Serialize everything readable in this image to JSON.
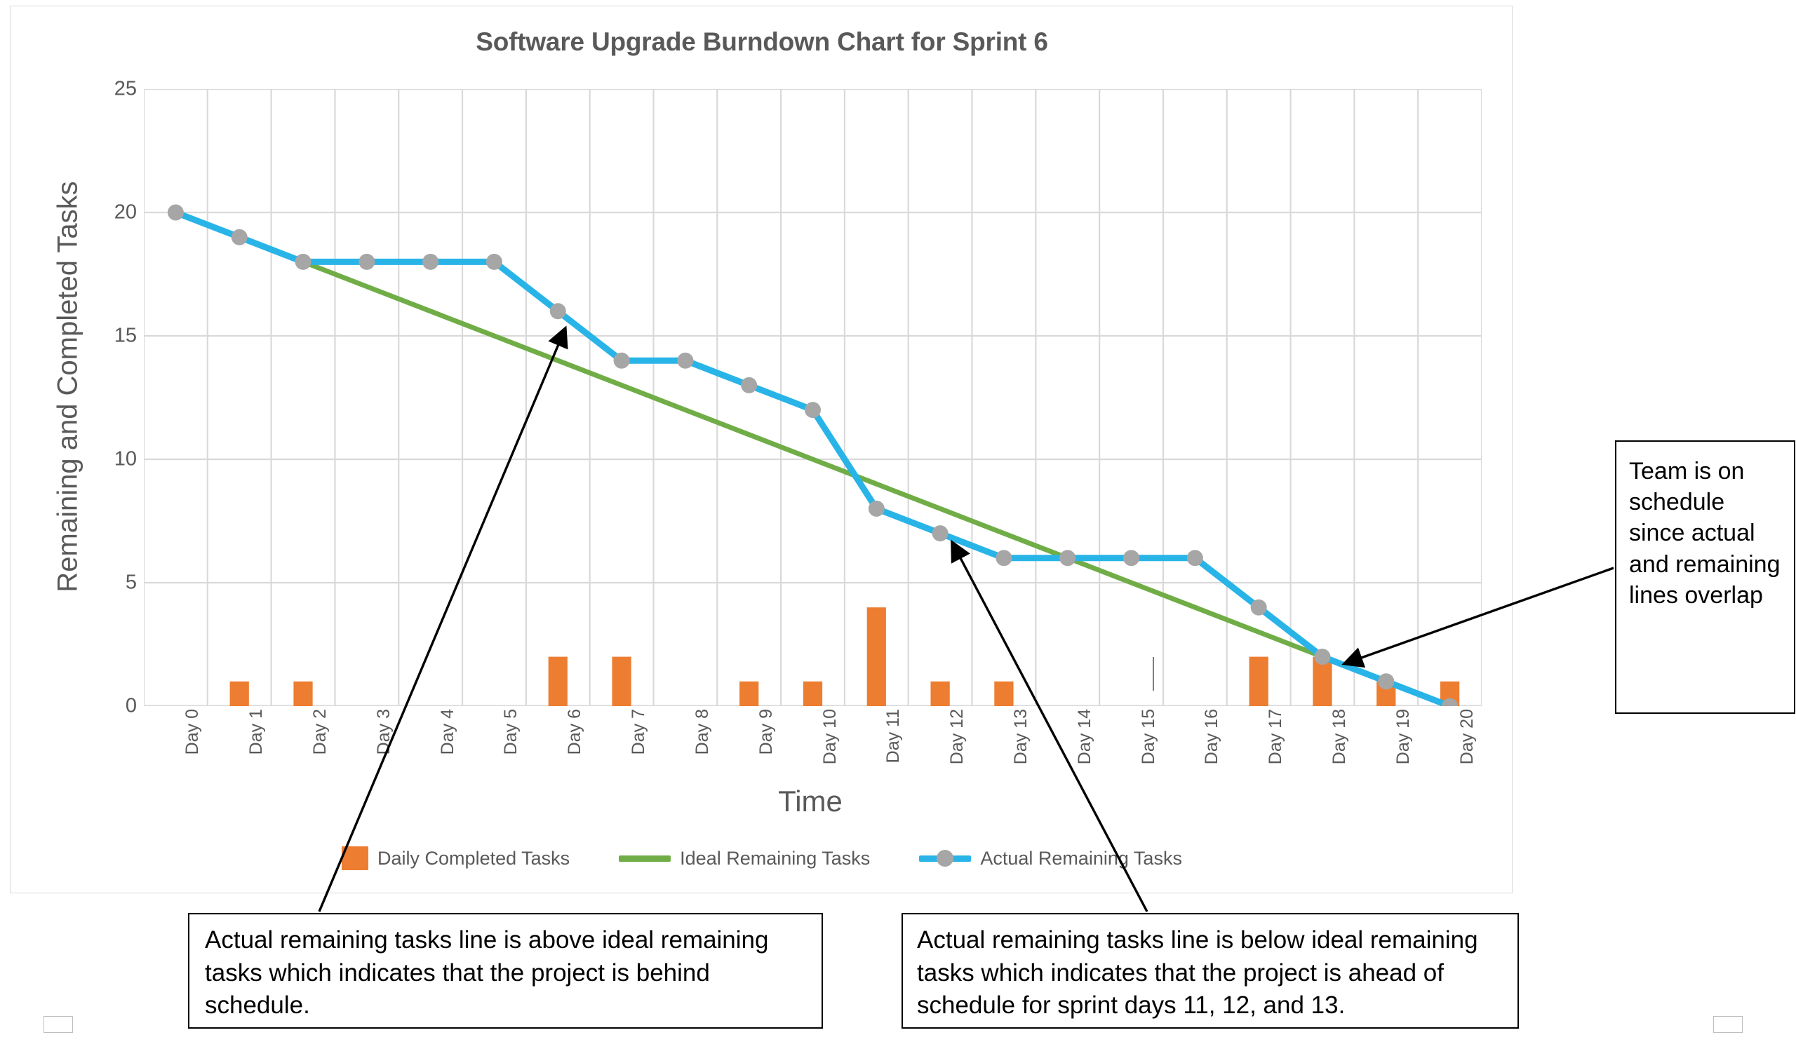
{
  "chart_data": {
    "type": "bar",
    "title": "Software Upgrade Burndown Chart for Sprint 6",
    "xlabel": "Time",
    "ylabel": "Remaining and Completed Tasks",
    "ylim": [
      0,
      25
    ],
    "yticks": [
      0,
      5,
      10,
      15,
      20,
      25
    ],
    "grid": true,
    "legend_position": "bottom",
    "categories": [
      "Day 0",
      "Day 1",
      "Day 2",
      "Day 3",
      "Day 4",
      "Day 5",
      "Day 6",
      "Day 7",
      "Day 8",
      "Day 9",
      "Day 10",
      "Day 11",
      "Day 12",
      "Day 13",
      "Day 14",
      "Day 15",
      "Day 16",
      "Day 17",
      "Day 18",
      "Day 19",
      "Day 20"
    ],
    "series": [
      {
        "name": "Daily Completed Tasks",
        "type": "bar",
        "color": "#ED7D31",
        "values": [
          0,
          1,
          1,
          0,
          0,
          0,
          2,
          2,
          0,
          1,
          1,
          4,
          1,
          1,
          0,
          0,
          0,
          2,
          2,
          1,
          1
        ]
      },
      {
        "name": "Ideal Remaining Tasks",
        "type": "line",
        "color": "#70AD47",
        "values": [
          null,
          null,
          18,
          17,
          16,
          15,
          14,
          13,
          12,
          11,
          10,
          9,
          8,
          7,
          6,
          5,
          4,
          3,
          2,
          1,
          0
        ]
      },
      {
        "name": "Actual Remaining Tasks",
        "type": "line",
        "color": "#29B4E8",
        "marker_color": "#A6A6A6",
        "values": [
          20,
          19,
          18,
          18,
          18,
          18,
          16,
          14,
          14,
          13,
          12,
          8,
          7,
          6,
          6,
          6,
          6,
          4,
          2,
          1,
          0
        ]
      }
    ]
  },
  "chart": {
    "title": "Software Upgrade Burndown Chart for Sprint 6",
    "x_axis_title": "Time",
    "y_axis_title": "Remaining and Completed Tasks"
  },
  "legend": {
    "items": [
      {
        "label": "Daily Completed Tasks",
        "color": "#ED7D31",
        "marker": "bar"
      },
      {
        "label": "Ideal Remaining Tasks",
        "color": "#70AD47",
        "marker": "line"
      },
      {
        "label": "Actual Remaining Tasks",
        "color": "#29B4E8",
        "marker": "line-dot"
      }
    ]
  },
  "annotations": [
    {
      "id": "behind-schedule",
      "text": "Actual remaining tasks line is above ideal remaining tasks which indicates that the project is behind schedule."
    },
    {
      "id": "ahead-of-schedule",
      "text": "Actual remaining tasks line is below ideal remaining tasks which indicates that the project is ahead of schedule for sprint days 11, 12, and 13."
    },
    {
      "id": "on-schedule",
      "text": "Team is on schedule since actual and remaining lines overlap"
    }
  ],
  "colors": {
    "bar": "#ED7D31",
    "ideal_line": "#70AD47",
    "actual_line": "#29B4E8",
    "marker": "#A6A6A6",
    "text": "#595959",
    "grid": "#D9D9D9"
  }
}
